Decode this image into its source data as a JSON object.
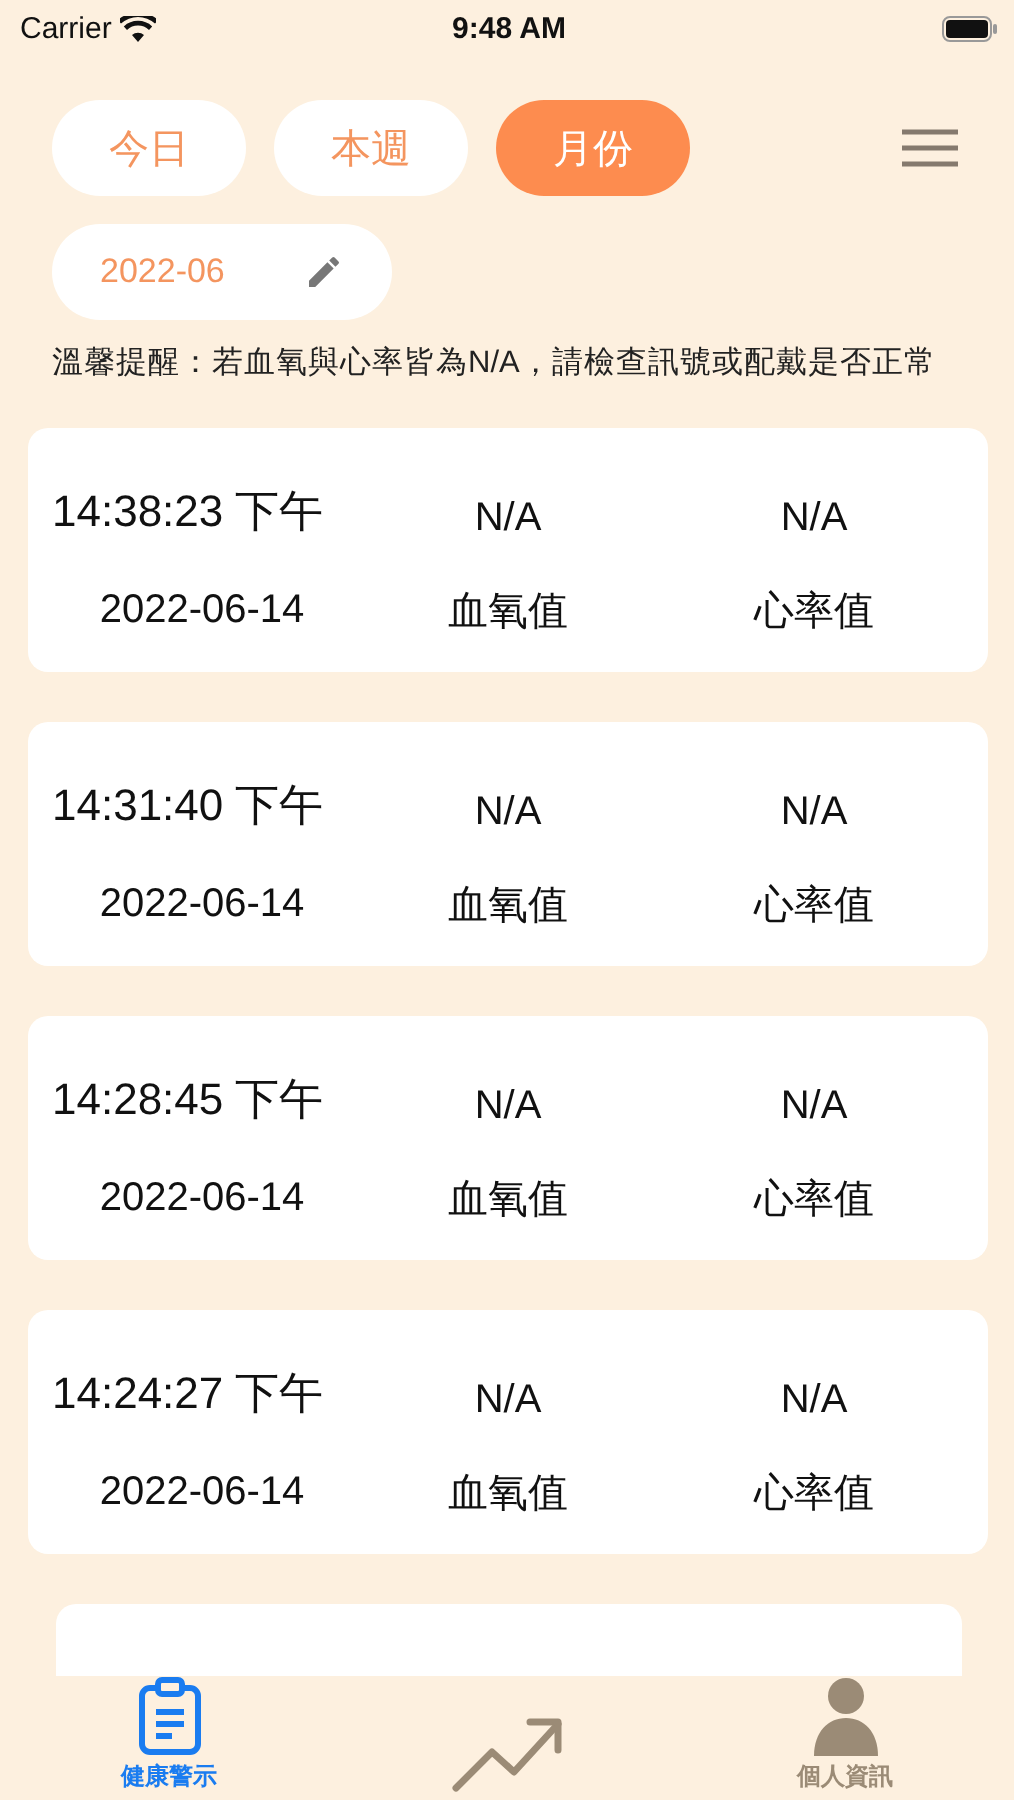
{
  "status_bar": {
    "carrier": "Carrier",
    "time": "9:48 AM"
  },
  "segments": [
    {
      "label": "今日",
      "selected": false
    },
    {
      "label": "本週",
      "selected": false
    },
    {
      "label": "月份",
      "selected": true
    }
  ],
  "month_picker": {
    "value": "2022-06"
  },
  "notice": "溫馨提醒：若血氧與心率皆為N/A，請檢查訊號或配戴是否正常",
  "records": [
    {
      "time": "14:38:23 下午",
      "date": "2022-06-14",
      "blood_oxygen": "N/A",
      "blood_oxygen_label": "血氧值",
      "heart_rate": "N/A",
      "heart_rate_label": "心率值"
    },
    {
      "time": "14:31:40 下午",
      "date": "2022-06-14",
      "blood_oxygen": "N/A",
      "blood_oxygen_label": "血氧值",
      "heart_rate": "N/A",
      "heart_rate_label": "心率值"
    },
    {
      "time": "14:28:45 下午",
      "date": "2022-06-14",
      "blood_oxygen": "N/A",
      "blood_oxygen_label": "血氧值",
      "heart_rate": "N/A",
      "heart_rate_label": "心率值"
    },
    {
      "time": "14:24:27 下午",
      "date": "2022-06-14",
      "blood_oxygen": "N/A",
      "blood_oxygen_label": "血氧值",
      "heart_rate": "N/A",
      "heart_rate_label": "心率值"
    }
  ],
  "tab_bar": [
    {
      "kind": "clipboard",
      "label": "健康警示",
      "selected": true
    },
    {
      "kind": "trend",
      "selected": false
    },
    {
      "kind": "person",
      "label": "個人資訊",
      "selected": false
    }
  ]
}
